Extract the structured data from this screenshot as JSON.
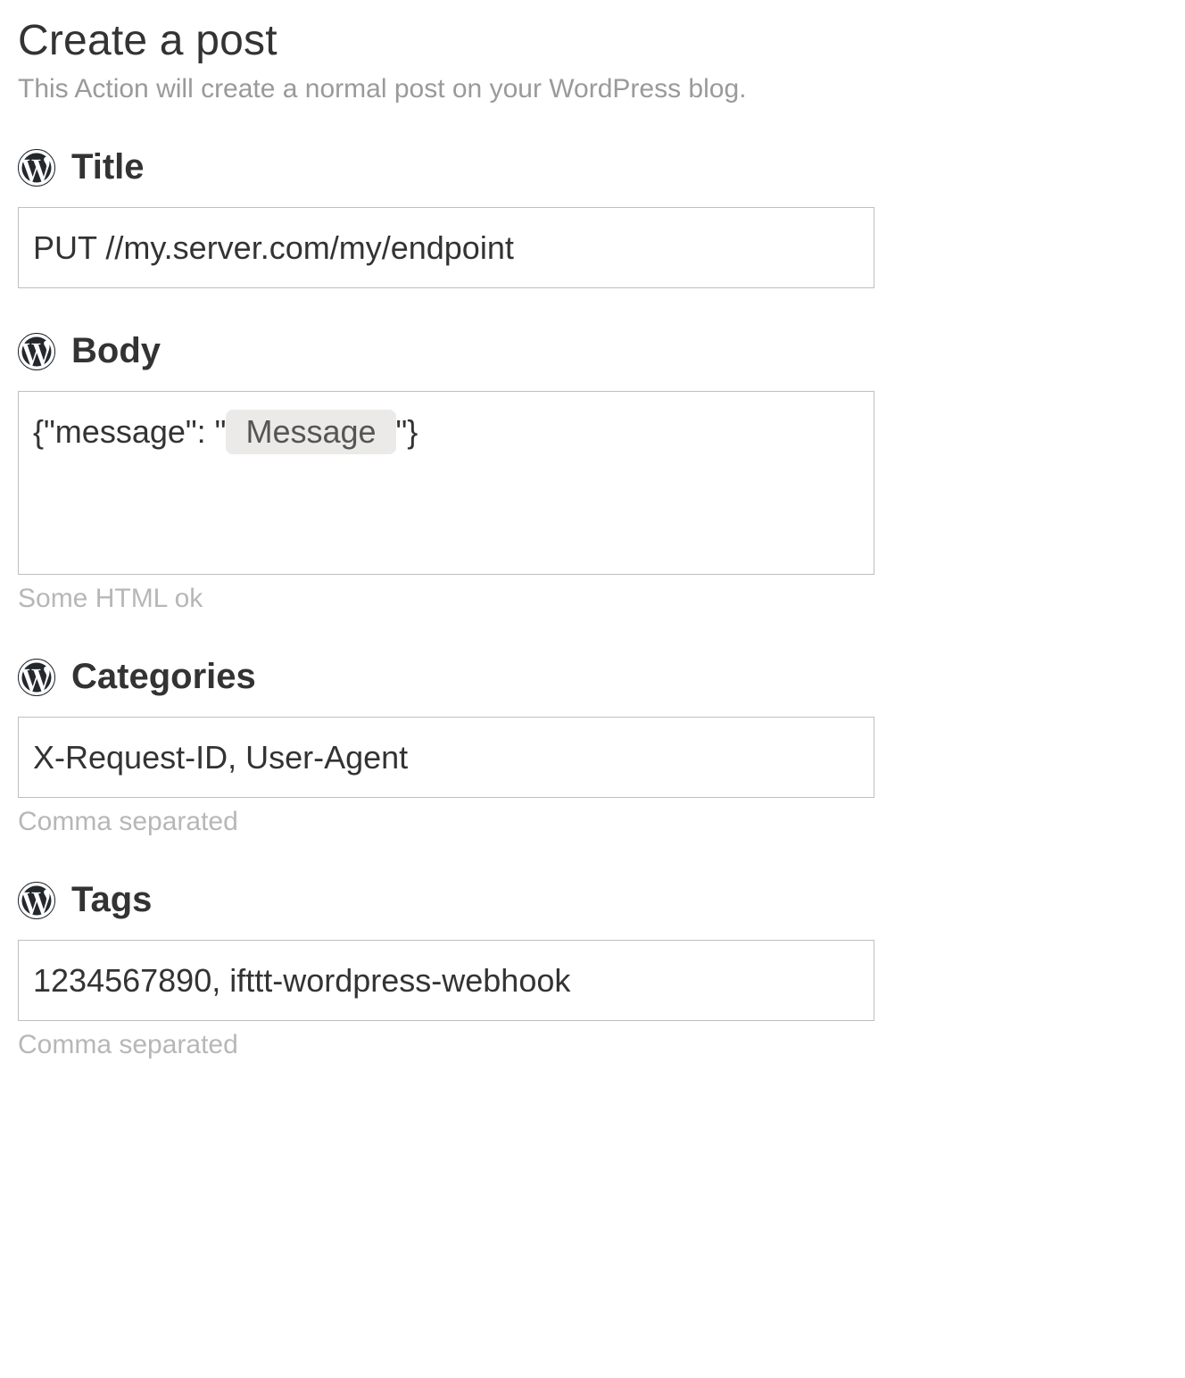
{
  "page": {
    "title": "Create a post",
    "description": "This Action will create a normal post on your WordPress blog."
  },
  "fields": {
    "title": {
      "label": "Title",
      "value": "PUT //my.server.com/my/endpoint"
    },
    "body": {
      "label": "Body",
      "prefix": "{\"message\": \"",
      "pill": "Message",
      "suffix": "\"}",
      "hint": "Some HTML ok"
    },
    "categories": {
      "label": "Categories",
      "value": "X-Request-ID, User-Agent",
      "hint": "Comma separated"
    },
    "tags": {
      "label": "Tags",
      "value": "1234567890, ifttt-wordpress-webhook",
      "hint": "Comma separated"
    }
  }
}
